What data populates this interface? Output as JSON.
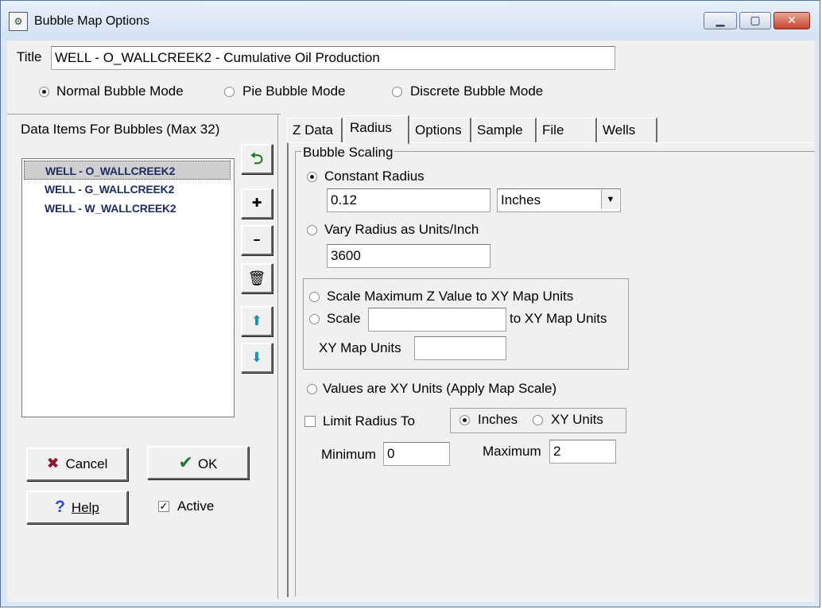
{
  "window": {
    "title": "Bubble Map Options",
    "min_glyph": "▁",
    "max_glyph": "▢",
    "close_glyph": "✕"
  },
  "title_row": {
    "label": "Title",
    "value": "WELL - O_WALLCREEK2  - Cumulative Oil Production"
  },
  "modes": [
    {
      "label": "Normal Bubble Mode",
      "selected": true
    },
    {
      "label": "Pie Bubble Mode",
      "selected": false
    },
    {
      "label": "Discrete Bubble Mode",
      "selected": false
    }
  ],
  "data_items": {
    "header": "Data Items For Bubbles (Max 32)",
    "items": [
      {
        "label": "WELL - O_WALLCREEK2",
        "selected": true
      },
      {
        "label": "WELL - G_WALLCREEK2",
        "selected": false
      },
      {
        "label": "WELL - W_WALLCREEK2",
        "selected": false
      }
    ]
  },
  "side_buttons": {
    "undo": "⮌",
    "add": "✚",
    "remove": "━",
    "delete": "🗑",
    "up": "⬆",
    "down": "⬇"
  },
  "bottom_buttons": {
    "cancel_label": "Cancel",
    "cancel_icon": "✖",
    "ok_label": "OK",
    "ok_icon": "✔",
    "help_label": "Help",
    "help_icon": "?",
    "active_label": "Active",
    "active_checked": true
  },
  "tabs": [
    {
      "label": "Z Data"
    },
    {
      "label": "Radius",
      "active": true
    },
    {
      "label": "Options"
    },
    {
      "label": "Sample"
    },
    {
      "label": "File"
    },
    {
      "label": "Wells"
    }
  ],
  "radius": {
    "group_title": "Bubble Scaling",
    "constant_radius_label": "Constant Radius",
    "constant_radius_value": "0.12",
    "units_selected": "Inches",
    "vary_radius_label": "Vary Radius as Units/Inch",
    "vary_radius_value": "3600",
    "scale_max_label": "Scale Maximum Z Value to XY Map Units",
    "scale_label": "Scale",
    "scale_value": "",
    "scale_suffix": "to XY Map Units",
    "xy_map_units_label": "XY Map Units",
    "xy_map_units_value": "",
    "values_xy_label": "Values are XY Units  (Apply Map Scale)",
    "limit_radius_label": "Limit Radius To",
    "limit_inches_label": "Inches",
    "limit_xy_label": "XY Units",
    "minimum_label": "Minimum",
    "minimum_value": "0",
    "maximum_label": "Maximum",
    "maximum_value": "2"
  }
}
